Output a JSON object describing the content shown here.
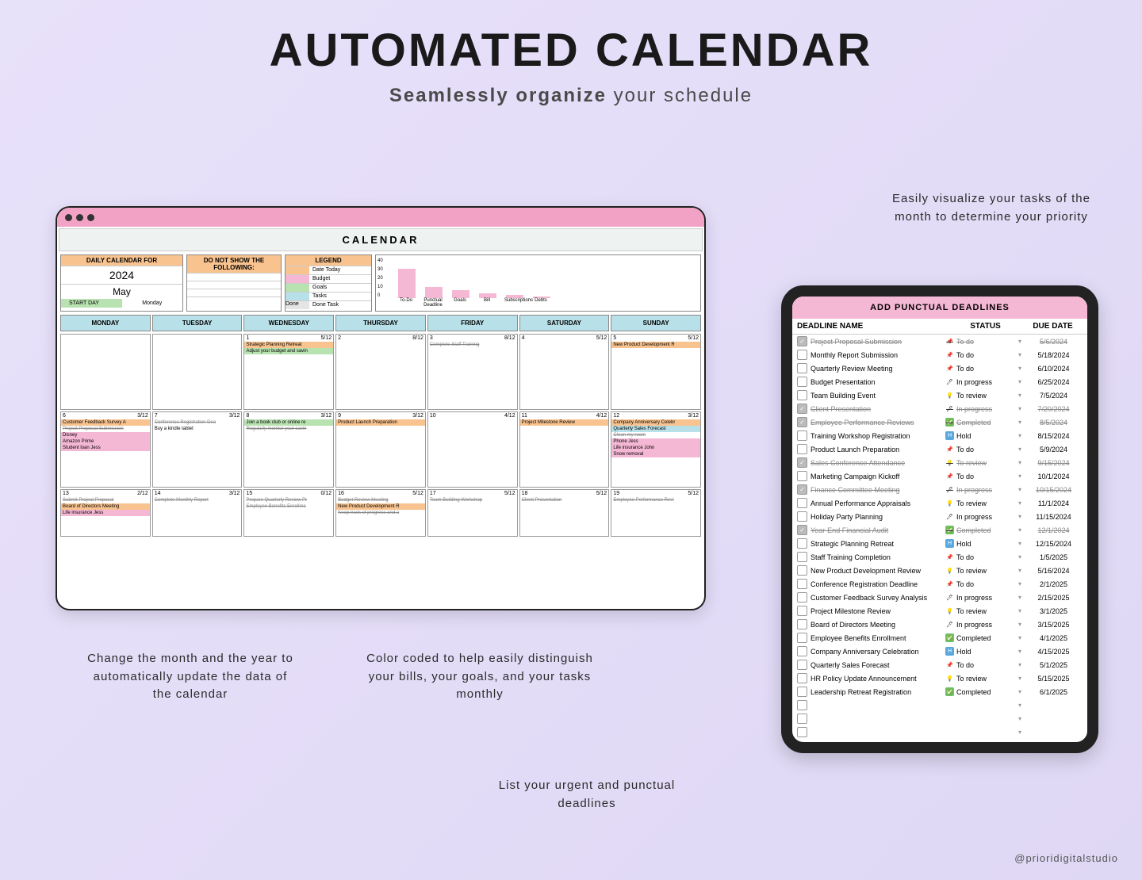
{
  "title": "AUTOMATED CALENDAR",
  "subtitle_bold": "Seamlessly organize",
  "subtitle_rest": " your schedule",
  "callouts": {
    "c1": "Easily visualize your tasks of the month to determine your priority",
    "c2": "Change the month and the year to automatically update the data of the calendar",
    "c3": "Color coded to help easily distinguish your bills, your goals, and your tasks monthly",
    "c4": "List your urgent and punctual deadlines"
  },
  "credit": "@prioridigitalstudio",
  "calendar": {
    "heading": "CALENDAR",
    "daily_label": "DAILY CALENDAR FOR",
    "year": "2024",
    "month": "May",
    "start_day_label": "START DAY",
    "start_day_value": "Monday",
    "donot_label": "DO NOT SHOW THE FOLLOWING:",
    "legend_label": "LEGEND",
    "legend": [
      {
        "color": "#f9c38f",
        "label": "Date Today"
      },
      {
        "color": "#f5b8d4",
        "label": "Budget"
      },
      {
        "color": "#b8e2b0",
        "label": "Goals"
      },
      {
        "color": "#b8e0e8",
        "label": "Tasks"
      },
      {
        "color": "#e5e5e5",
        "label": "Done Task",
        "prefix": "Done"
      }
    ],
    "days": [
      "MONDAY",
      "TUESDAY",
      "WEDNESDAY",
      "THURSDAY",
      "FRIDAY",
      "SATURDAY",
      "SUNDAY"
    ]
  },
  "chart_data": {
    "type": "bar",
    "categories": [
      "To-Do",
      "Punctual Deadline",
      "Goals",
      "Bill",
      "Subscriptions",
      "Debts"
    ],
    "values": [
      30,
      11,
      8,
      5,
      3,
      2
    ],
    "ylim": [
      0,
      40
    ],
    "yticks": [
      0,
      10,
      20,
      30,
      40
    ]
  },
  "weeks": [
    [
      {
        "n": "",
        "sub": ""
      },
      {
        "n": "",
        "sub": ""
      },
      {
        "n": "1",
        "sub": "5/12",
        "events": [
          {
            "t": "Strategic Planning Retreat",
            "c": "orange"
          },
          {
            "t": "Adjust your budget and savin",
            "c": "green"
          }
        ]
      },
      {
        "n": "2",
        "sub": "8/12",
        "events": []
      },
      {
        "n": "3",
        "sub": "8/12",
        "events": [
          {
            "t": "Complete Staff Training",
            "c": "strike"
          }
        ]
      },
      {
        "n": "4",
        "sub": "5/12",
        "events": []
      },
      {
        "n": "5",
        "sub": "5/12",
        "events": [
          {
            "t": "New Product Development R",
            "c": "orange"
          }
        ]
      }
    ],
    [
      {
        "n": "6",
        "sub": "3/12",
        "events": [
          {
            "t": "Customer Feedback Survey A",
            "c": "orange"
          },
          {
            "t": "Project Proposal Submission",
            "c": "strike"
          },
          {
            "t": "Disney",
            "c": "pink"
          },
          {
            "t": "Amazon Prime",
            "c": "pink"
          },
          {
            "t": "Student loan Jess",
            "c": "pink"
          }
        ]
      },
      {
        "n": "7",
        "sub": "3/12",
        "events": [
          {
            "t": "Conference Registration Dea",
            "c": "strike"
          },
          {
            "t": "Buy a kindle tablet",
            "c": ""
          }
        ]
      },
      {
        "n": "8",
        "sub": "3/12",
        "events": [
          {
            "t": "Join a book club or online re",
            "c": "green"
          },
          {
            "t": "Regularly monitor your savin",
            "c": "strike"
          }
        ]
      },
      {
        "n": "9",
        "sub": "3/12",
        "events": [
          {
            "t": "Product Launch Preparation",
            "c": "orange"
          }
        ]
      },
      {
        "n": "10",
        "sub": "4/12",
        "events": []
      },
      {
        "n": "11",
        "sub": "4/12",
        "events": [
          {
            "t": "Project Milestone Review",
            "c": "orange"
          }
        ]
      },
      {
        "n": "12",
        "sub": "3/12",
        "events": [
          {
            "t": "Company Anniversary Celebr",
            "c": "orange"
          },
          {
            "t": "Quarterly Sales Forecast",
            "c": "blue"
          },
          {
            "t": "Clean my room",
            "c": "strike"
          },
          {
            "t": "Phone Jess",
            "c": "pink"
          },
          {
            "t": "Life insurance John",
            "c": "pink"
          },
          {
            "t": "Snow removal",
            "c": "pink"
          }
        ]
      }
    ],
    [
      {
        "n": "13",
        "sub": "2/12",
        "events": [
          {
            "t": "Submit Project Proposal",
            "c": "strike"
          },
          {
            "t": "Board of Directors Meeting",
            "c": "orange"
          },
          {
            "t": "Life insurance Jess",
            "c": "pink"
          }
        ]
      },
      {
        "n": "14",
        "sub": "3/12",
        "events": [
          {
            "t": "Complete Monthly Report",
            "c": "strike"
          }
        ]
      },
      {
        "n": "15",
        "sub": "0/12",
        "events": [
          {
            "t": "Prepare Quarterly Review Pr",
            "c": "strike"
          },
          {
            "t": "Employee Benefits Enrollme",
            "c": "strike"
          }
        ]
      },
      {
        "n": "16",
        "sub": "5/12",
        "events": [
          {
            "t": "Budget Review Meeting",
            "c": "strike"
          },
          {
            "t": "New Product Development R",
            "c": "orange"
          },
          {
            "t": "Keep track of progress and a",
            "c": "strike"
          }
        ]
      },
      {
        "n": "17",
        "sub": "5/12",
        "events": [
          {
            "t": "Team Building Workshop",
            "c": "strike"
          }
        ]
      },
      {
        "n": "18",
        "sub": "5/12",
        "events": [
          {
            "t": "Client Presentation",
            "c": "strike"
          }
        ]
      },
      {
        "n": "19",
        "sub": "5/12",
        "events": [
          {
            "t": "Employee Performance Revi",
            "c": "strike"
          }
        ]
      }
    ]
  ],
  "tablet": {
    "title": "ADD PUNCTUAL DEADLINES",
    "col1": "DEADLINE NAME",
    "col2": "STATUS",
    "col3": "DUE DATE"
  },
  "deadlines": [
    {
      "done": true,
      "name": "Project Proposal Submission",
      "status": "To do",
      "icon": "📌",
      "date": "5/6/2024"
    },
    {
      "done": false,
      "name": "Monthly Report Submission",
      "status": "To do",
      "icon": "📌",
      "date": "5/18/2024"
    },
    {
      "done": false,
      "name": "Quarterly Review Meeting",
      "status": "To do",
      "icon": "📌",
      "date": "6/10/2024"
    },
    {
      "done": false,
      "name": "Budget Presentation",
      "status": "In progress",
      "icon": "🖊",
      "date": "6/25/2024"
    },
    {
      "done": false,
      "name": "Team Building Event",
      "status": "To review",
      "icon": "💡",
      "date": "7/5/2024"
    },
    {
      "done": true,
      "name": "Client Presentation",
      "status": "In progress",
      "icon": "🖊",
      "date": "7/20/2024"
    },
    {
      "done": true,
      "name": "Employee Performance Reviews",
      "status": "Completed",
      "icon": "✅",
      "date": "8/5/2024"
    },
    {
      "done": false,
      "name": "Training Workshop Registration",
      "status": "Hold",
      "icon": "H",
      "date": "8/15/2024"
    },
    {
      "done": false,
      "name": "Product Launch Preparation",
      "status": "To do",
      "icon": "📌",
      "date": "5/9/2024"
    },
    {
      "done": true,
      "name": "Sales Conference Attendance",
      "status": "To review",
      "icon": "💡",
      "date": "9/15/2024"
    },
    {
      "done": false,
      "name": "Marketing Campaign Kickoff",
      "status": "To do",
      "icon": "📌",
      "date": "10/1/2024"
    },
    {
      "done": true,
      "name": "Finance Committee Meeting",
      "status": "In progress",
      "icon": "🖊",
      "date": "10/15/2024"
    },
    {
      "done": false,
      "name": "Annual Performance Appraisals",
      "status": "To review",
      "icon": "💡",
      "date": "11/1/2024"
    },
    {
      "done": false,
      "name": "Holiday Party Planning",
      "status": "In progress",
      "icon": "🖊",
      "date": "11/15/2024"
    },
    {
      "done": true,
      "name": "Year-End Financial Audit",
      "status": "Completed",
      "icon": "✅",
      "date": "12/1/2024"
    },
    {
      "done": false,
      "name": "Strategic Planning Retreat",
      "status": "Hold",
      "icon": "H",
      "date": "12/15/2024"
    },
    {
      "done": false,
      "name": "Staff Training Completion",
      "status": "To do",
      "icon": "📌",
      "date": "1/5/2025"
    },
    {
      "done": false,
      "name": "New Product Development Review",
      "status": "To review",
      "icon": "💡",
      "date": "5/16/2024"
    },
    {
      "done": false,
      "name": "Conference Registration Deadline",
      "status": "To do",
      "icon": "📌",
      "date": "2/1/2025"
    },
    {
      "done": false,
      "name": "Customer Feedback Survey Analysis",
      "status": "In progress",
      "icon": "🖊",
      "date": "2/15/2025"
    },
    {
      "done": false,
      "name": "Project Milestone Review",
      "status": "To review",
      "icon": "💡",
      "date": "3/1/2025"
    },
    {
      "done": false,
      "name": "Board of Directors Meeting",
      "status": "In progress",
      "icon": "🖊",
      "date": "3/15/2025"
    },
    {
      "done": false,
      "name": "Employee Benefits Enrollment",
      "status": "Completed",
      "icon": "✅",
      "date": "4/1/2025"
    },
    {
      "done": false,
      "name": "Company Anniversary Celebration",
      "status": "Hold",
      "icon": "H",
      "date": "4/15/2025"
    },
    {
      "done": false,
      "name": "Quarterly Sales Forecast",
      "status": "To do",
      "icon": "📌",
      "date": "5/1/2025"
    },
    {
      "done": false,
      "name": "HR Policy Update Announcement",
      "status": "To review",
      "icon": "💡",
      "date": "5/15/2025"
    },
    {
      "done": false,
      "name": "Leadership Retreat Registration",
      "status": "Completed",
      "icon": "✅",
      "date": "6/1/2025"
    }
  ]
}
